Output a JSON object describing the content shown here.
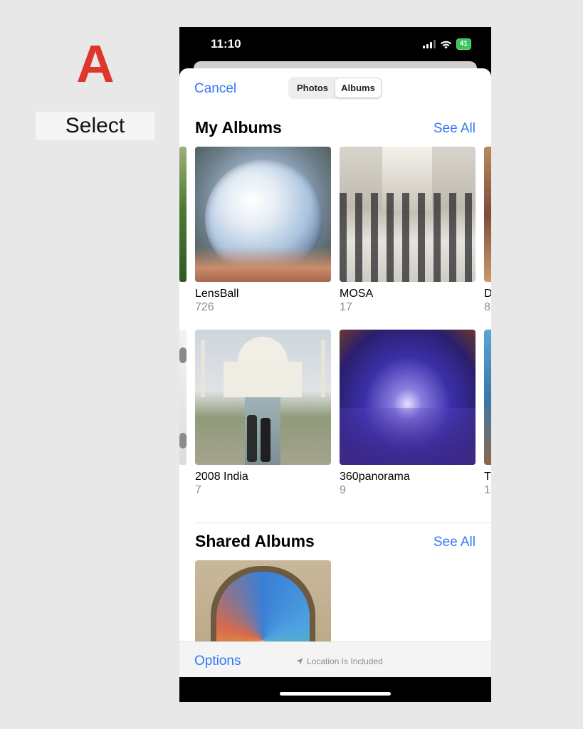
{
  "step": {
    "letter": "A",
    "label": "Select"
  },
  "status_bar": {
    "time": "11:10",
    "battery": "41"
  },
  "header": {
    "cancel_label": "Cancel",
    "tabs": [
      {
        "label": "Photos",
        "selected": false
      },
      {
        "label": "Albums",
        "selected": true
      }
    ]
  },
  "my_albums": {
    "title": "My Albums",
    "see_all_label": "See All",
    "albums": [
      {
        "name": "LensBall",
        "count": "726"
      },
      {
        "name": "MOSA",
        "count": "17"
      },
      {
        "name": "2008 India",
        "count": "7"
      },
      {
        "name": "360panorama",
        "count": "9"
      }
    ],
    "partial_right": [
      {
        "name": "D",
        "count": "8"
      },
      {
        "name": "T",
        "count": "1"
      }
    ]
  },
  "shared_albums": {
    "title": "Shared Albums",
    "see_all_label": "See All"
  },
  "toolbar": {
    "options_label": "Options",
    "location_label": "Location Is Included"
  },
  "colors": {
    "accent": "#3478f6",
    "step_letter": "#e0352b",
    "battery": "#34c759"
  }
}
